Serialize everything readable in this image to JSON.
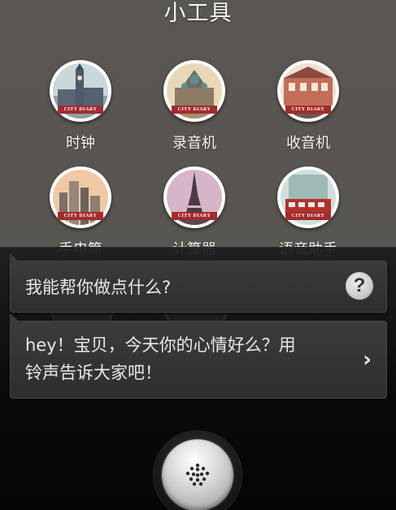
{
  "header": {
    "title": "小工具"
  },
  "tools": [
    {
      "label": "时钟",
      "scene": "big-ben",
      "badge_text": "CITY DIARY"
    },
    {
      "label": "录音机",
      "scene": "cathedral",
      "badge_text": "CITY DIARY"
    },
    {
      "label": "收音机",
      "scene": "old-building",
      "badge_text": "CITY DIARY"
    },
    {
      "label": "手电筒",
      "scene": "skyline",
      "badge_text": "CITY DIARY"
    },
    {
      "label": "计算器",
      "scene": "eiffel-tower",
      "badge_text": "CITY DIARY"
    },
    {
      "label": "语音助手",
      "scene": "bus",
      "badge_text": "CITY DIARY"
    }
  ],
  "assistant": {
    "prompt": "我能帮你做点什么?",
    "help_icon": "?",
    "reply_line1": "hey！宝贝，今天你的心情好么？用",
    "reply_line2": "铃声告诉大家吧！",
    "reply_arrow": "›",
    "mic_icon": "microphone-grille-icon"
  },
  "colors": {
    "background": "#57544f",
    "bubble": "#333333",
    "badge_ribbon": "#a32b2b",
    "text": "#f2f2f2"
  }
}
